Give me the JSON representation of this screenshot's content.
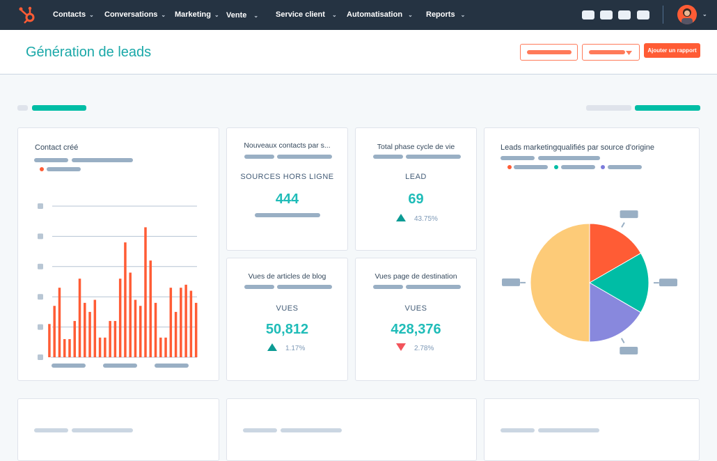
{
  "nav": {
    "items": [
      "Contacts",
      "Conversations",
      "Marketing",
      "Vente",
      "Service client",
      "Automatisation",
      "Reports"
    ],
    "chevron": "⌄"
  },
  "header": {
    "title": "Génération de leads",
    "add_report": "Ajouter un rapport"
  },
  "colors": {
    "accent": "#ff5c35",
    "teal": "#00bda5",
    "nav_bg": "#253342"
  },
  "cards": {
    "contact_cree": {
      "title": "Contact créé"
    },
    "nouveaux": {
      "title": "Nouveaux contacts par s...",
      "label": "SOURCES HORS LIGNE",
      "value": "444"
    },
    "cycle": {
      "title": "Total phase cycle de vie",
      "label": "LEAD",
      "value": "69",
      "change": "43.75%",
      "direction": "up"
    },
    "blog": {
      "title": "Vues de articles de blog",
      "label": "VUES",
      "value": "50,812",
      "change": "1.17%",
      "direction": "up"
    },
    "dest": {
      "title": "Vues page de destination",
      "label": "VUES",
      "value": "428,376",
      "change": "2.78%",
      "direction": "down"
    },
    "leads": {
      "title": "Leads marketingqualifiés par source d'origine"
    }
  },
  "chart_data": [
    {
      "type": "bar",
      "title": "Contact créé",
      "ylim": [
        0,
        5
      ],
      "grid": true,
      "color": "#ff5c35",
      "values": [
        1.1,
        1.7,
        2.3,
        0.6,
        0.6,
        1.2,
        2.6,
        1.8,
        1.5,
        1.9,
        0.65,
        0.65,
        1.2,
        1.2,
        2.6,
        3.8,
        2.8,
        1.9,
        1.7,
        4.3,
        3.2,
        1.8,
        0.65,
        0.65,
        2.3,
        1.5,
        2.3,
        2.4,
        2.2,
        1.8
      ]
    },
    {
      "type": "pie",
      "title": "Leads marketingqualifiés par source d'origine",
      "values": [
        16.7,
        16.7,
        16.7,
        50
      ],
      "colors": [
        "#ff5c35",
        "#00bda5",
        "#8888dd",
        "#fdcb78"
      ]
    }
  ]
}
